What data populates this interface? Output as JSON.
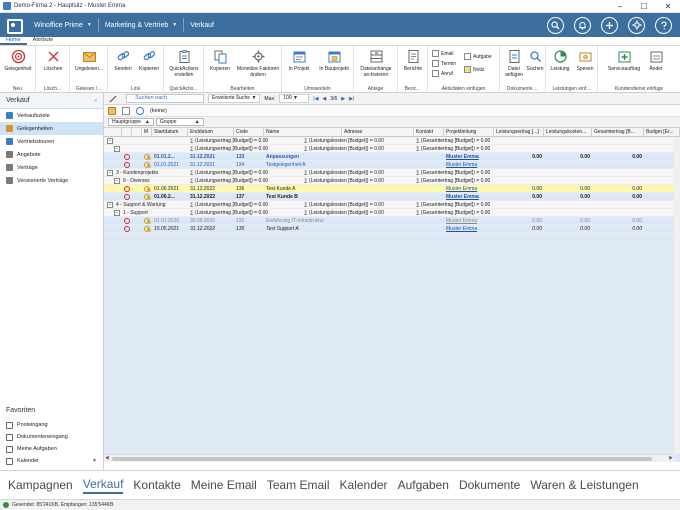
{
  "window": {
    "title": "Demo-Firma 2 - Hauptsitz - Muster Emma",
    "minimize": "–",
    "maximize": "☐",
    "close": "✕"
  },
  "nav": {
    "crumbs": [
      {
        "label": "Winoffice Prime"
      },
      {
        "label": "Marketing & Vertrieb"
      },
      {
        "label": "Verkauf"
      }
    ],
    "icons": [
      "search-icon",
      "bell-icon",
      "plus-icon",
      "gear-icon",
      "help-icon"
    ]
  },
  "ribbon_tabs": [
    "Home",
    "Attribute"
  ],
  "ribbon": {
    "groups": [
      {
        "label": "Neu",
        "buttons": [
          "Gelegenheit"
        ]
      },
      {
        "label": "Lösch...",
        "buttons": [
          "Löschen"
        ]
      },
      {
        "label": "Gelesen /...",
        "buttons": [
          "Ungelesen..."
        ]
      },
      {
        "label": "Link",
        "buttons": [
          "Senden",
          "Kopieren"
        ]
      },
      {
        "label": "QuickActio...",
        "buttons": [
          "QuickActions erstellen"
        ]
      },
      {
        "label": "Bearbeiten",
        "buttons": [
          "Kopieren",
          "Monetäre Faktoren ändern"
        ]
      },
      {
        "label": "Umwandeln",
        "buttons": [
          "In Projekt",
          "In Bauprojekt"
        ]
      },
      {
        "label": "Ablage",
        "buttons": [
          "Dateianhänge archivieren"
        ]
      },
      {
        "label": "Beric...",
        "buttons": [
          "Berichte"
        ]
      },
      {
        "label": "Aktivitäten einfügen",
        "small": [
          "Email",
          "Termin",
          "Anruf",
          "Aufgabe",
          "Notiz"
        ]
      },
      {
        "label": "Dokumente ...",
        "buttons": [
          "Datei anfügen",
          "Suchen"
        ]
      },
      {
        "label": "Leistungen einf...",
        "buttons": [
          "Leistung",
          "Spesen"
        ]
      },
      {
        "label": "Kundendienst einfüge",
        "buttons": [
          "Serviceauftrag",
          "Änder"
        ]
      }
    ]
  },
  "sidebar": {
    "title": "Verkauf",
    "pin": "«",
    "items": [
      {
        "label": "Verkaufsziele",
        "color": "#3a7fc4"
      },
      {
        "label": "Gelegenheiten",
        "color": "#d9932a"
      },
      {
        "label": "Vertriebstouren",
        "color": "#3a7fc4"
      },
      {
        "label": "Angebote",
        "color": "#7a7a7a"
      },
      {
        "label": "Verträge",
        "color": "#7a7a7a"
      },
      {
        "label": "Versionierte Verträge",
        "color": "#7a7a7a"
      }
    ],
    "favorites_title": "Favoriten",
    "favorites": [
      {
        "label": "Posteingang"
      },
      {
        "label": "Dokumenteneingang"
      },
      {
        "label": "Meine Aufgaben"
      },
      {
        "label": "Kalender"
      }
    ]
  },
  "toolbar": {
    "search_placeholder": "Suchen nach",
    "advanced_search": "Erweiterte Suche",
    "max_label": "Max:",
    "max_value": "100",
    "page_info": "3/6",
    "none_label": "(keine)"
  },
  "grouping": {
    "chips": [
      "Hauptgruppe",
      "Gruppe"
    ]
  },
  "grid": {
    "columns": [
      {
        "label": ""
      },
      {
        "label": ""
      },
      {
        "label": "M"
      },
      {
        "label": "Startdatum"
      },
      {
        "label": "Enddatum"
      },
      {
        "label": "Code"
      },
      {
        "label": "Name"
      },
      {
        "label": "Adresse"
      },
      {
        "label": "Kontakt"
      },
      {
        "label": "Projektleitung"
      },
      {
        "label": "Leistungsertrag [...]"
      },
      {
        "label": "Leistungskosten..."
      },
      {
        "label": "Gesamtertrag [B..."
      },
      {
        "label": "Budget [Er..."
      }
    ],
    "sum_texts": {
      "ertrag": "∑ (Leistungsertrag [Budget]) = 0.00",
      "kosten": "∑ (Leistungskosten [Budget]) = 0.00",
      "gesamt": "∑ (Gesamtertrag [Budget]) = 0.00"
    },
    "groups": [
      {
        "header": "",
        "rows": [
          {
            "start": "01.01.2...",
            "end": "31.12.2021",
            "code": "133",
            "name": "Anpassungen",
            "leiter": "Muster Emma",
            "e": "0.00",
            "k": "0.00",
            "g": "0.00",
            "style": "bold-blue"
          },
          {
            "start": "01.01.2021",
            "end": "31.12.2021",
            "code": "134",
            "name": "Testgelegenheit A",
            "leiter": "Muster Emma",
            "e": "",
            "k": "",
            "g": "",
            "style": "blue"
          }
        ]
      },
      {
        "header": "3 - Kundenprojekte",
        "sub": "9 - Diverses",
        "rows": [
          {
            "start": "01.06.2021",
            "end": "31.12.2022",
            "code": "136",
            "name": "Test Kunde A",
            "leiter": "Muster Emma",
            "e": "0.00",
            "k": "0.00",
            "g": "0.00",
            "style": "yellow"
          },
          {
            "start": "01.06.2...",
            "end": "31.12.2022",
            "code": "137",
            "name": "Test Kunde B",
            "leiter": "Muster Emma",
            "e": "0.00",
            "k": "0.00",
            "g": "0.00",
            "style": "bold"
          }
        ]
      },
      {
        "header": "4 - Support & Wartung",
        "sub": "1 - Support",
        "rows": [
          {
            "start": "01.01.2020",
            "end": "30.06.2020",
            "code": "132",
            "name": "Einführung IT-Infrastruktur",
            "leiter": "Muster Emma",
            "e": "0.00",
            "k": "0.00",
            "g": "0.00",
            "style": "gray"
          },
          {
            "start": "15.05.2021",
            "end": "31.12.2022",
            "code": "135",
            "name": "Test Support A",
            "leiter": "Muster Emma",
            "e": "0.00",
            "k": "0.00",
            "g": "0.00",
            "style": "italic"
          }
        ]
      }
    ]
  },
  "modules": [
    "Kampagnen",
    "Verkauf",
    "Kontakte",
    "Meine Email",
    "Team Email",
    "Kalender",
    "Aufgaben",
    "Dokumente",
    "Waren & Leistungen"
  ],
  "active_module": "Verkauf",
  "status": "Gesendet: 85'241KB, Empfangen: 135'544KB"
}
